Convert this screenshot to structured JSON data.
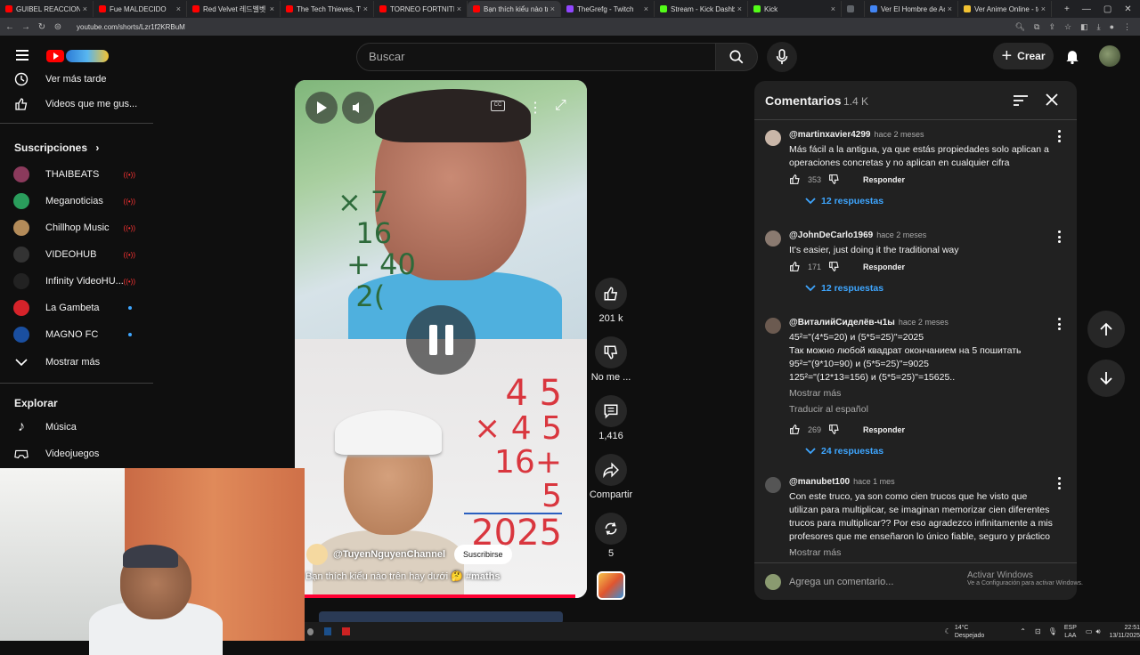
{
  "browser": {
    "tabs": [
      {
        "title": "GUIBEL REACCIONA A DA",
        "color": "#ff0000"
      },
      {
        "title": "Fue MALDECIDO",
        "color": "#ff0000"
      },
      {
        "title": "Red Velvet 레드벨벳 '러시",
        "color": "#ff0000"
      },
      {
        "title": "The Tech Thieves, Twosi",
        "color": "#ff0000"
      },
      {
        "title": "TORNEO FORTNITE 50.00",
        "color": "#ff0000"
      },
      {
        "title": "Bạn thích kiểu nào tr",
        "color": "#ff0000",
        "active": true
      },
      {
        "title": "TheGrefg - Twitch",
        "color": "#9146ff"
      },
      {
        "title": "Stream - Kick Dashboard",
        "color": "#53fc18"
      },
      {
        "title": "Kick",
        "color": "#53fc18"
      },
      {
        "title": "",
        "color": "#5f6368"
      },
      {
        "title": "Ver El Hombre de Acer",
        "color": "#4285f4"
      },
      {
        "title": "Ver Anime Online - todo",
        "color": "#f2c232"
      }
    ],
    "url": "youtube.com/shorts/Lzr1f2KRBuM"
  },
  "header": {
    "search_placeholder": "Buscar",
    "create_label": "Crear"
  },
  "sidebar": {
    "top_items": [
      {
        "label": "Ver más tarde",
        "icon": "clock-icon"
      },
      {
        "label": "Videos que me gus...",
        "icon": "thumb-up-icon"
      }
    ],
    "subs_title": "Suscripciones",
    "subs": [
      {
        "label": "THAIBEATS",
        "status": "live",
        "color": "#8b3a5c"
      },
      {
        "label": "Meganoticias",
        "status": "live",
        "color": "#2a9d5c"
      },
      {
        "label": "Chillhop Music",
        "status": "live",
        "color": "#b38b59"
      },
      {
        "label": "VIDEOHUB",
        "status": "live",
        "color": "#333333"
      },
      {
        "label": "Infinity VideoHU...",
        "status": "live",
        "color": "#222222"
      },
      {
        "label": "La Gambeta",
        "status": "new",
        "color": "#d6232a"
      },
      {
        "label": "MAGNO FC",
        "status": "new",
        "color": "#1a4fa0"
      }
    ],
    "show_more": "Mostrar más",
    "explore_title": "Explorar",
    "explore_items": [
      {
        "label": "Música",
        "icon": "music-note-icon"
      },
      {
        "label": "Videojuegos",
        "icon": "gamepad-icon"
      }
    ]
  },
  "short": {
    "channel": "@TuyenNguyenChannel",
    "subscribe": "Suscribirse",
    "title": "Bạn thích kiểu nào trên hay dưới 🤔",
    "hashtag": "#maths",
    "board_top": "×\n16\n+ 40\n2",
    "board_bottom": [
      "4 5",
      "× 4 5",
      "16+ 5",
      "2025"
    ],
    "progress": 0.96
  },
  "actions": {
    "likes": "201 k",
    "dislike": "No me ...",
    "comments": "1,416",
    "share": "Compartir",
    "remix": "5"
  },
  "comments": {
    "title": "Comentarios",
    "count": "1.4 K",
    "items": [
      {
        "user": "@martinxavier4299",
        "time": "hace 2 meses",
        "text": "Más fácil a la antigua, ya que estás propiedades solo aplican a operaciones concretas y no aplican en cualquier cifra",
        "likes": "353",
        "reply": "Responder",
        "replies": "12 respuestas",
        "avatar_color": "#c9b6a8"
      },
      {
        "user": "@JohnDeCarlo1969",
        "time": "hace 2 meses",
        "text": "It's easier, just doing it the traditional way",
        "likes": "171",
        "reply": "Responder",
        "replies": "12 respuestas",
        "avatar_color": "#8a7a70"
      },
      {
        "user": "@ВиталийСиделёв-ч1ы",
        "time": "hace 2 meses",
        "text": "45²=\"(4*5=20) и (5*5=25)\"=2025\nТак можно любой квадрат окончанием на 5 пошитать\n95²=\"(9*10=90) и (5*5=25)\"=9025\n125²=\"(12*13=156) и (5*5=25)\"=15625..",
        "more": "Mostrar más",
        "translate": "Traducir al español",
        "likes": "269",
        "reply": "Responder",
        "replies": "24 respuestas",
        "avatar_color": "#6b5a50"
      },
      {
        "user": "@manubet100",
        "time": "hace 1 mes",
        "text": "Con este truco, ya son como cien trucos que he visto que utilizan para multiplicar, se imaginan memorizar cien diferentes trucos para multiplicar?? Por eso agradezco infinitamente a mis profesores que me enseñaron lo único fiable, seguro y práctico ..",
        "more": "Mostrar más",
        "avatar_color": "#555555"
      }
    ],
    "add_placeholder": "Agrega un comentario..."
  },
  "watermark": {
    "title": "Activar Windows",
    "sub": "Ve a Configuración para activar Windows."
  },
  "taskbar": {
    "temp": "14°C",
    "weather": "Despejado",
    "lang": "ESP",
    "layout": "LAA",
    "time": "22:51",
    "date": "13/11/2025"
  }
}
